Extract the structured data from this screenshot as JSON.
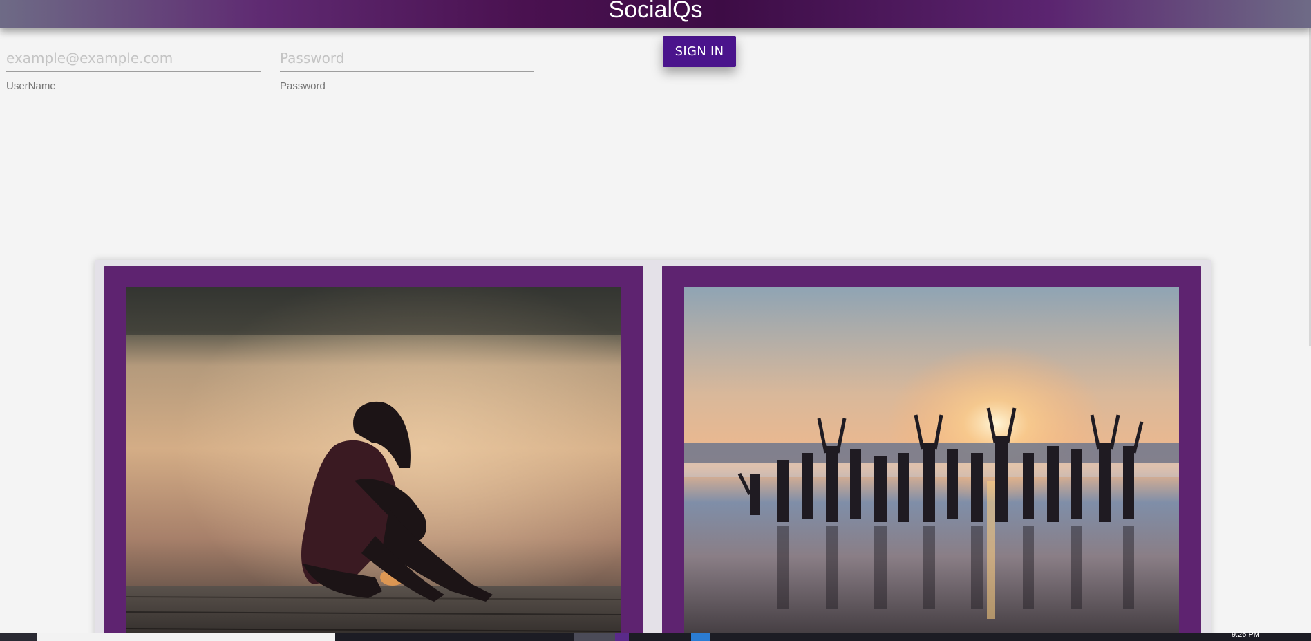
{
  "header": {
    "title": "SocialQs"
  },
  "form": {
    "username": {
      "placeholder": "example@example.com",
      "value": "",
      "label": "UserName"
    },
    "password": {
      "placeholder": "Password",
      "value": "",
      "label": "Password"
    },
    "signin_label": "SIGN IN"
  },
  "cards": [
    {
      "image": "sad-woman-sitting-on-dock-photo"
    },
    {
      "image": "happy-people-jumping-on-beach-photo"
    }
  ],
  "taskbar": {
    "clock": "9:26 PM"
  },
  "colors": {
    "header_primary": "#4a1150",
    "button": "#4a148c",
    "card": "#5e2370",
    "background": "#f4f4f4"
  }
}
